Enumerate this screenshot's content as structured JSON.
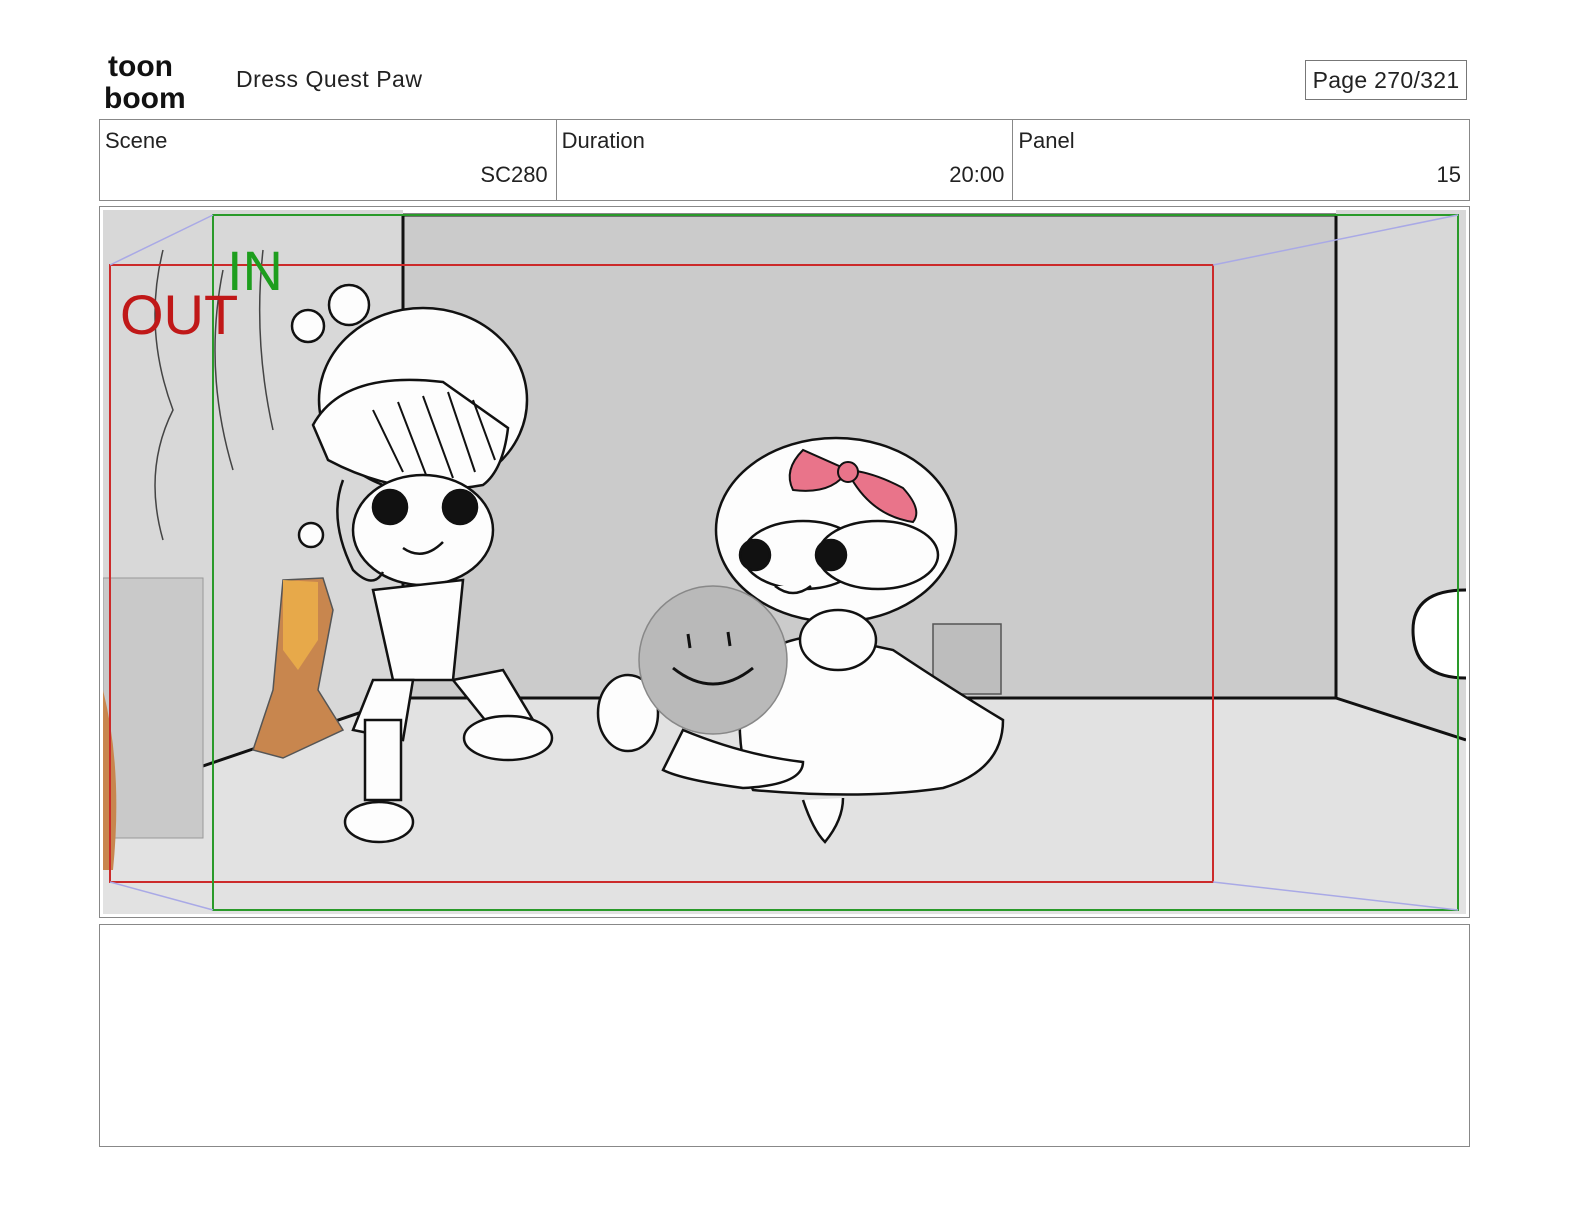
{
  "header": {
    "logo_text_top": "toon",
    "logo_text_bottom": "boom",
    "project_title": "Dress Quest Paw",
    "page_counter": "Page 270/321"
  },
  "info": {
    "scene_label": "Scene",
    "scene_value": "SC280",
    "duration_label": "Duration",
    "duration_value": "20:00",
    "panel_label": "Panel",
    "panel_value": "15"
  },
  "panel": {
    "camera_out_label": "OUT",
    "camera_in_label": "IN",
    "colors": {
      "out_frame": "#cc2a2a",
      "in_frame": "#2a9a2a",
      "back_wall": "#cbcbcb",
      "floor": "#e2e2e2",
      "side_wall": "#d8d8d8",
      "bow": "#e9748a",
      "guide_lines": "#a9a9e6"
    }
  },
  "caption": {
    "text": ""
  }
}
